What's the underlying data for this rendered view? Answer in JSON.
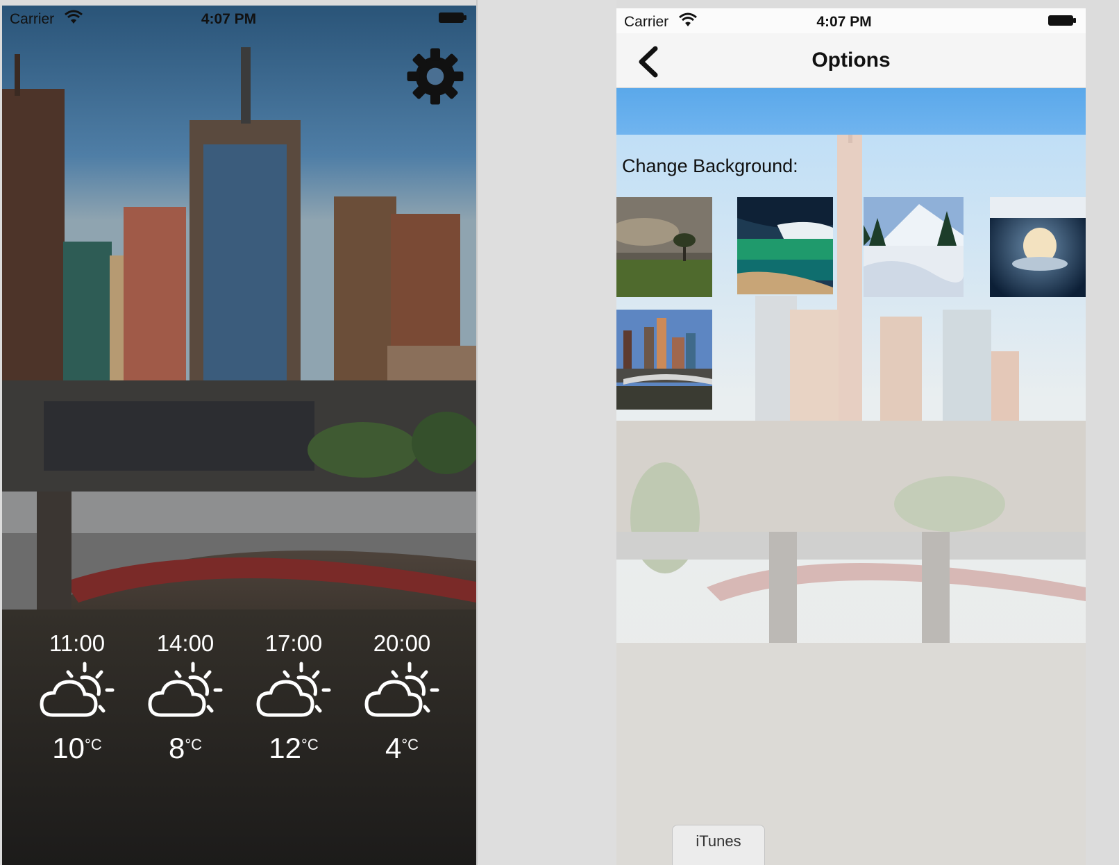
{
  "left_screen": {
    "status": {
      "carrier": "Carrier",
      "time": "4:07 PM"
    },
    "settings_icon": "gear-icon",
    "forecast": [
      {
        "time": "11:00",
        "temp": "10",
        "unit": "°C",
        "icon": "partly-cloudy-icon"
      },
      {
        "time": "14:00",
        "temp": "8",
        "unit": "°C",
        "icon": "partly-cloudy-icon"
      },
      {
        "time": "17:00",
        "temp": "12",
        "unit": "°C",
        "icon": "partly-cloudy-icon"
      },
      {
        "time": "20:00",
        "temp": "4",
        "unit": "°C",
        "icon": "partly-cloudy-icon"
      }
    ]
  },
  "right_screen": {
    "status": {
      "carrier": "Carrier",
      "time": "4:07 PM"
    },
    "nav": {
      "title": "Options",
      "back_icon": "chevron-left-icon"
    },
    "change_background_label": "Change Background:",
    "backgrounds": [
      "field-tree",
      "ocean-storm",
      "snow-mountain",
      "cloud-sky",
      "city-bridge"
    ],
    "dock_tab_label": "iTunes"
  },
  "colors": {
    "sky": "#4a7aa8",
    "nav_bg": "#f5f5f5",
    "options_sky": "#64aeea"
  }
}
